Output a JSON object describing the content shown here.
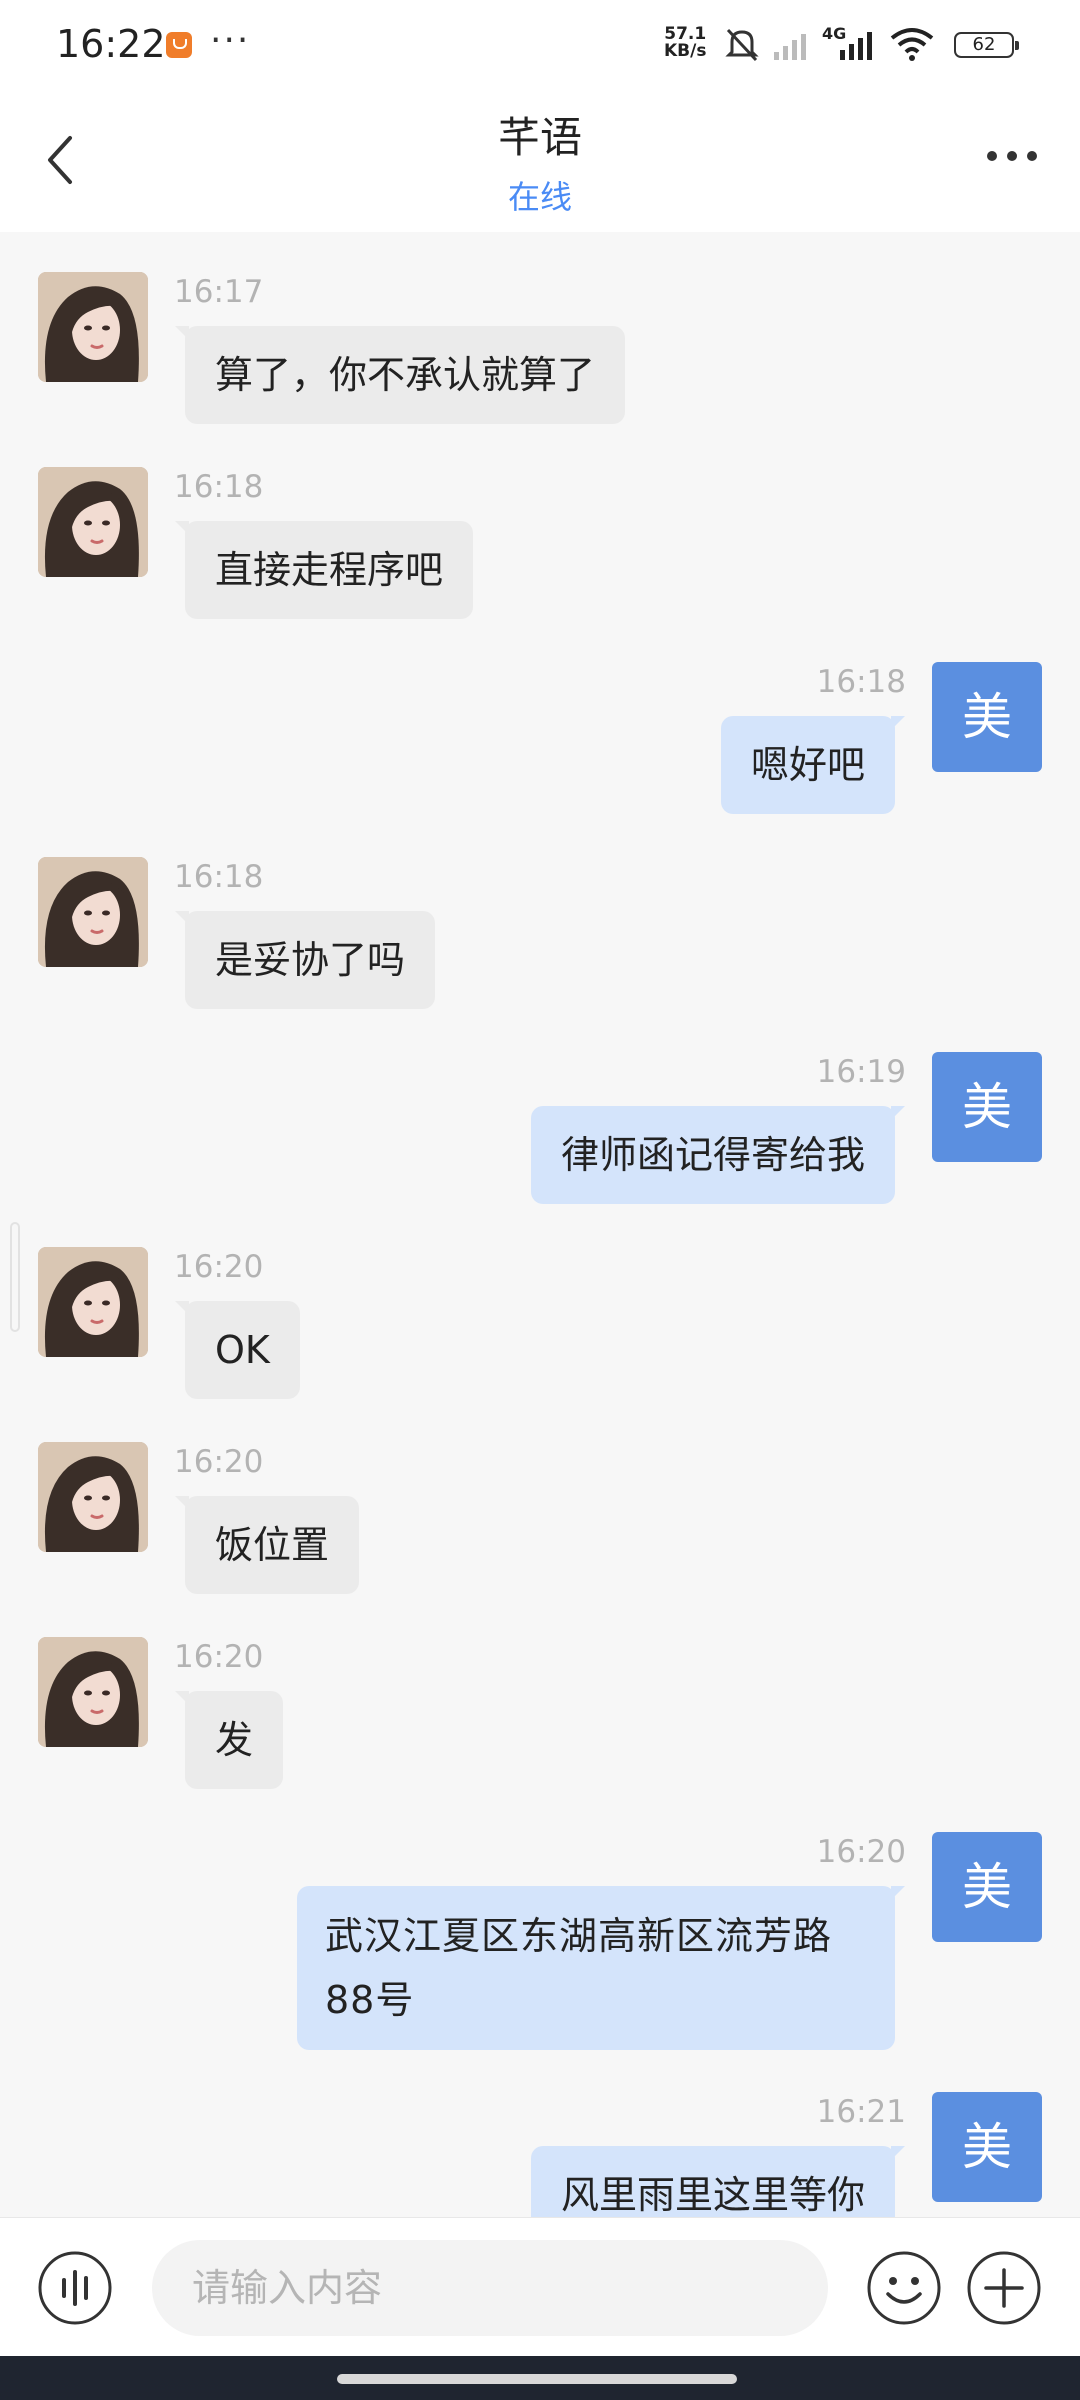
{
  "status_bar": {
    "time": "16:22",
    "more": "···",
    "net_speed_value": "57.1",
    "net_speed_unit": "KB/s",
    "network_type": "4G",
    "battery": "62",
    "icons": [
      "app-notification-icon",
      "mute-icon",
      "signal-sim2-icon",
      "signal-4g-icon",
      "wifi-icon",
      "battery-icon"
    ]
  },
  "header": {
    "title": "芊语",
    "status": "在线"
  },
  "my_avatar_text": "美",
  "messages": [
    {
      "side": "in",
      "time": "16:17",
      "text": "算了，你不承认就算了"
    },
    {
      "side": "in",
      "time": "16:18",
      "text": "直接走程序吧"
    },
    {
      "side": "out",
      "time": "16:18",
      "text": "嗯好吧"
    },
    {
      "side": "in",
      "time": "16:18",
      "text": "是妥协了吗"
    },
    {
      "side": "out",
      "time": "16:19",
      "text": "律师函记得寄给我"
    },
    {
      "side": "in",
      "time": "16:20",
      "text": "OK"
    },
    {
      "side": "in",
      "time": "16:20",
      "text": "饭位置"
    },
    {
      "side": "in",
      "time": "16:20",
      "text": "发"
    },
    {
      "side": "out",
      "time": "16:20",
      "text": "武汉江夏区东湖高新区流芳路88号"
    },
    {
      "side": "out",
      "time": "16:21",
      "text": "风里雨里这里等你"
    }
  ],
  "input_bar": {
    "placeholder": "请输入内容",
    "value": ""
  },
  "colors": {
    "accent": "#4a8bf5",
    "my_avatar": "#5b8fe0",
    "incoming_bubble": "#ebebeb",
    "outgoing_bubble": "#d4e4fb",
    "background": "#f7f7f7"
  }
}
